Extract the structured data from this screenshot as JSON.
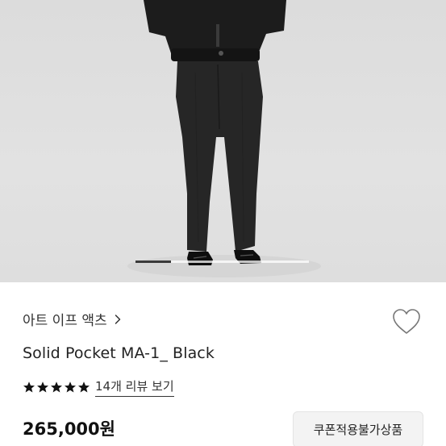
{
  "product_image": {
    "alt": ""
  },
  "carousel": {
    "current_index": 1,
    "progress_fraction": 0.2
  },
  "brand": {
    "name": "아트 이프 액츠",
    "chevron_icon": "chevron-right-icon"
  },
  "wishlist": {
    "icon": "heart-outline-icon"
  },
  "product": {
    "name": "Solid Pocket MA-1_ Black"
  },
  "rating": {
    "stars": 5,
    "max_stars": 5,
    "review_link": "14개 리뷰 보기"
  },
  "price": {
    "display": "265,000원"
  },
  "coupon": {
    "label": "쿠폰적용불가상품"
  },
  "colors": {
    "star": "#111111",
    "hero_bg": "#dedede",
    "coupon_bg": "#f3f3f3"
  }
}
